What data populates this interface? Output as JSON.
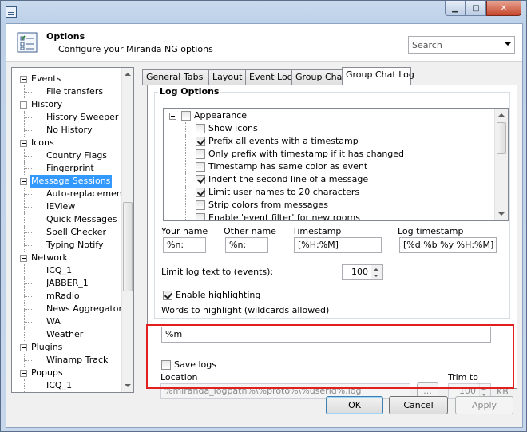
{
  "window": {
    "caption_buttons": [
      "minimize",
      "maximize",
      "close"
    ]
  },
  "header": {
    "title": "Options",
    "subtitle": "Configure your Miranda NG options",
    "search_placeholder": "Search"
  },
  "tree": [
    {
      "label": "Events",
      "level": 0
    },
    {
      "label": "File transfers",
      "level": 1
    },
    {
      "label": "History",
      "level": 0
    },
    {
      "label": "History Sweeper Li",
      "level": 1
    },
    {
      "label": "No History",
      "level": 1
    },
    {
      "label": "Icons",
      "level": 0
    },
    {
      "label": "Country Flags",
      "level": 1
    },
    {
      "label": "Fingerprint",
      "level": 1
    },
    {
      "label": "Message Sessions",
      "level": 0,
      "selected": true
    },
    {
      "label": "Auto-replacements",
      "level": 1
    },
    {
      "label": "IEView",
      "level": 1
    },
    {
      "label": "Quick Messages",
      "level": 1
    },
    {
      "label": "Spell Checker",
      "level": 1
    },
    {
      "label": "Typing Notify",
      "level": 1
    },
    {
      "label": "Network",
      "level": 0
    },
    {
      "label": "ICQ_1",
      "level": 1
    },
    {
      "label": "JABBER_1",
      "level": 1
    },
    {
      "label": "mRadio",
      "level": 1
    },
    {
      "label": "News Aggregator",
      "level": 1
    },
    {
      "label": "WA",
      "level": 1
    },
    {
      "label": "Weather",
      "level": 1
    },
    {
      "label": "Plugins",
      "level": 0
    },
    {
      "label": "Winamp Track",
      "level": 1
    },
    {
      "label": "Popups",
      "level": 0
    },
    {
      "label": "ICQ_1",
      "level": 1
    }
  ],
  "tabs": [
    "General",
    "Tabs",
    "Layout",
    "Event Log",
    "Group Chat",
    "Group Chat Log"
  ],
  "active_tab": "Group Chat Log",
  "log_options": {
    "title": "Log Options",
    "group": "Appearance",
    "items": [
      {
        "label": "Show icons",
        "checked": false
      },
      {
        "label": "Prefix all events with a timestamp",
        "checked": true
      },
      {
        "label": "Only prefix with timestamp if it has changed",
        "checked": false
      },
      {
        "label": "Timestamp has same color as event",
        "checked": false
      },
      {
        "label": "Indent the second line of a message",
        "checked": true
      },
      {
        "label": "Limit user names to 20 characters",
        "checked": true
      },
      {
        "label": "Strip colors from messages",
        "checked": false
      },
      {
        "label": "Enable 'event filter' for new rooms",
        "checked": false
      }
    ]
  },
  "formats": {
    "your_name_label": "Your name",
    "your_name_value": "%n:",
    "other_name_label": "Other name",
    "other_name_value": "%n:",
    "timestamp_label": "Timestamp",
    "timestamp_value": "[%H:%M]",
    "log_timestamp_label": "Log timestamp",
    "log_timestamp_value": "[%d %b %y %H:%M]"
  },
  "limit_log": {
    "label": "Limit log text to (events):",
    "value": "100"
  },
  "highlighting": {
    "enable_label": "Enable highlighting",
    "enabled": true,
    "words_label": "Words to highlight (wildcards allowed)",
    "words_value": "%m"
  },
  "save_logs": {
    "label": "Save logs",
    "checked": false,
    "location_label": "Location",
    "location_value": "%miranda_logpath%\\%proto%\\%userid%.log",
    "browse_label": "...",
    "trim_label": "Trim to",
    "trim_value": "100",
    "trim_unit": "KB"
  },
  "buttons": {
    "ok": "OK",
    "cancel": "Cancel",
    "apply": "Apply"
  },
  "colors": {
    "selection": "#3399ff",
    "annotation_box": "#e0201e"
  }
}
